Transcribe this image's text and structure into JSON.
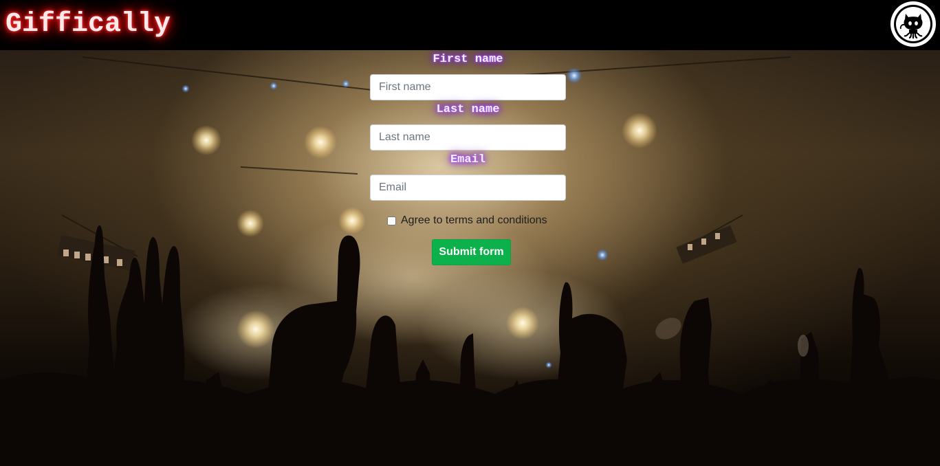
{
  "header": {
    "brand": "Giffically",
    "github_link": {
      "icon": "github-octocat-icon"
    },
    "brand_glow_color": "#ff1a1a"
  },
  "form": {
    "first_name": {
      "label": "First name",
      "placeholder": "First name",
      "value": ""
    },
    "last_name": {
      "label": "Last name",
      "placeholder": "Last name",
      "value": ""
    },
    "email": {
      "label": "Email",
      "placeholder": "Email",
      "value": ""
    },
    "terms": {
      "label": "Agree to terms and conditions",
      "checked": false
    },
    "submit_label": "Submit form",
    "label_glow_color": "#8a2be2",
    "submit_color": "#0db14b"
  },
  "background": {
    "image": "concert-crowd-image"
  }
}
